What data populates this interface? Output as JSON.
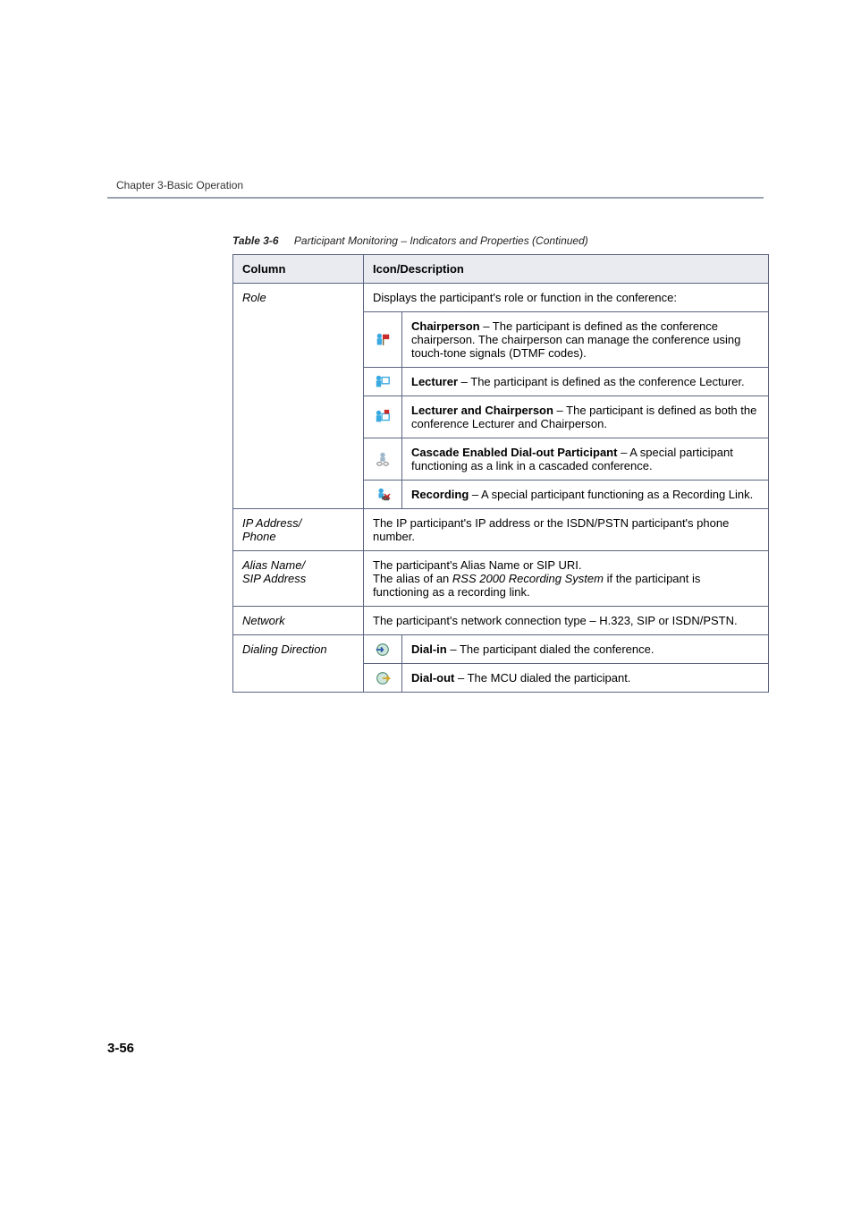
{
  "header": {
    "chapter": "Chapter 3-Basic Operation"
  },
  "caption": {
    "label": "Table 3-6",
    "title": "Participant Monitoring – Indicators and Properties (Continued)"
  },
  "table": {
    "head_col": "Column",
    "head_desc": "Icon/Description",
    "rows": {
      "role": {
        "label": "Role",
        "intro": "Displays the participant's role or function in the conference:",
        "chair_b": "Chairperson",
        "chair_t": " – The participant is defined as the conference chairperson. The chairperson can manage the conference using touch-tone signals (DTMF codes).",
        "lect_b": "Lecturer",
        "lect_t": " – The participant is defined as the conference Lecturer.",
        "lc_b": "Lecturer and Chairperson",
        "lc_t": " – The participant is defined as both the conference Lecturer and Chairperson.",
        "casc_b": "Cascade Enabled Dial-out Participant",
        "casc_t": " – A special participant functioning as a link in a cascaded conference.",
        "rec_b": "Recording",
        "rec_t": " – A special participant functioning as a Recording Link."
      },
      "ip": {
        "label": "IP Address/\nPhone",
        "desc": "The IP participant's IP address or the ISDN/PSTN participant's phone number."
      },
      "alias": {
        "label": "Alias Name/\nSIP Address",
        "l1": "The participant's Alias Name or SIP URI.",
        "l2a": "The alias of an ",
        "l2i": "RSS 2000 Recording System",
        "l2b": " if the participant is functioning as a recording link."
      },
      "network": {
        "label": "Network",
        "desc": "The participant's network connection type – H.323, SIP or ISDN/PSTN."
      },
      "dial": {
        "label": "Dialing Direction",
        "in_b": "Dial-in",
        "in_t": " – The participant dialed the conference.",
        "out_b": "Dial-out",
        "out_t": " – The MCU dialed the participant."
      }
    }
  },
  "page_number": "3-56"
}
